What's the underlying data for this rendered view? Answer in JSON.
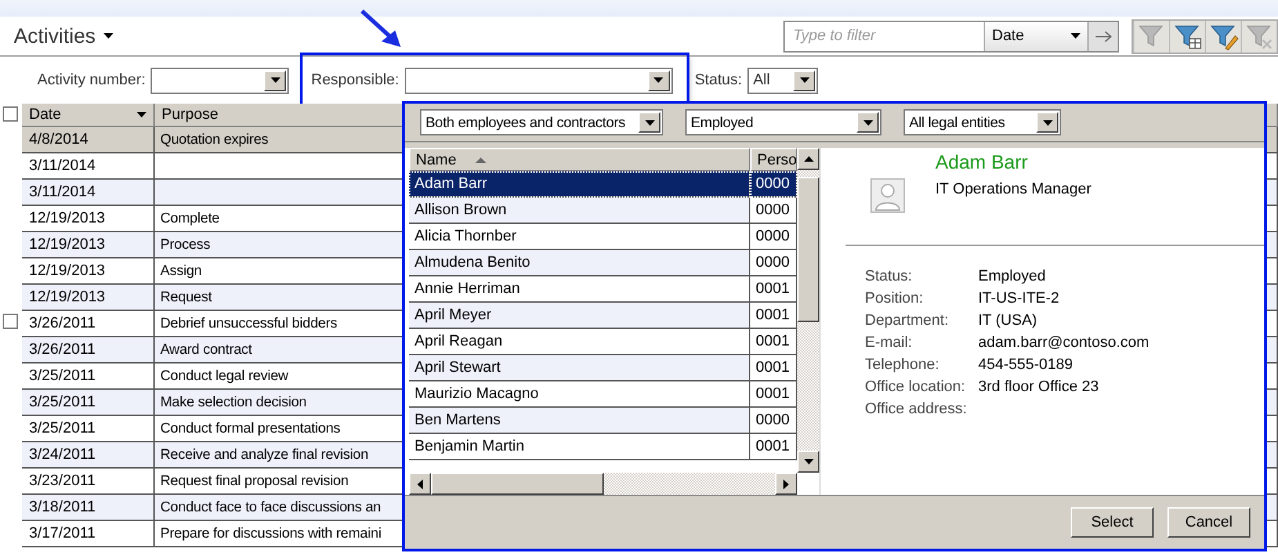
{
  "header": {
    "title": "Activities",
    "filter": {
      "placeholder": "Type to filter",
      "field": "Date"
    },
    "tools": [
      {
        "kind": "filter",
        "disabled": true
      },
      {
        "kind": "grid",
        "disabled": false
      },
      {
        "kind": "edit",
        "disabled": false
      },
      {
        "kind": "clear",
        "disabled": true
      }
    ]
  },
  "filters": [
    {
      "label": "Activity number:",
      "highlighted": false
    },
    {
      "label": "Responsible:",
      "highlighted": true
    },
    {
      "label": "Status:",
      "value": "All",
      "highlighted": false
    }
  ],
  "grid": {
    "select_all": {
      "checked": false
    },
    "columns": [
      "Date",
      "Purpose"
    ],
    "rows": [
      {
        "date": "4/8/2014",
        "purpose": "Quotation expires",
        "selected": true
      },
      {
        "date": "3/11/2014",
        "selected": false
      },
      {
        "date": "3/11/2014",
        "selected": false
      },
      {
        "date": "12/19/2013",
        "purpose": "Complete",
        "selected": false
      },
      {
        "date": "12/19/2013",
        "purpose": "Process",
        "selected": false
      },
      {
        "date": "12/19/2013",
        "purpose": "Assign",
        "selected": false
      },
      {
        "date": "12/19/2013",
        "purpose": "Request",
        "selected": false
      },
      {
        "date": "3/26/2011",
        "purpose": "Debrief unsuccessful bidders",
        "selected": false,
        "checkbox": {
          "checked": false
        }
      },
      {
        "date": "3/26/2011",
        "purpose": "Award contract",
        "selected": false
      },
      {
        "date": "3/25/2011",
        "purpose": "Conduct legal review",
        "selected": false
      },
      {
        "date": "3/25/2011",
        "purpose": "Make selection decision",
        "selected": false
      },
      {
        "date": "3/25/2011",
        "purpose": "Conduct formal presentations",
        "selected": false
      },
      {
        "date": "3/24/2011",
        "purpose": "Receive and analyze final revision",
        "selected": false
      },
      {
        "date": "3/23/2011",
        "purpose": "Request final proposal revision",
        "selected": false
      },
      {
        "date": "3/18/2011",
        "purpose": "Conduct face to face discussions an",
        "selected": false
      },
      {
        "date": "3/17/2011",
        "purpose": "Prepare for discussions with remaini",
        "selected": false
      }
    ]
  },
  "lookup": {
    "filters": [
      "Both employees and contractors",
      "Employed",
      "All legal entities"
    ],
    "columns": [
      "Name",
      "Perso"
    ],
    "rows": [
      {
        "name": "Adam Barr",
        "number": "0000",
        "selected": true
      },
      {
        "name": "Allison Brown",
        "number": "0000",
        "selected": false
      },
      {
        "name": "Alicia Thornber",
        "number": "0000",
        "selected": false
      },
      {
        "name": "Almudena Benito",
        "number": "0000",
        "selected": false
      },
      {
        "name": "Annie Herriman",
        "number": "0001",
        "selected": false
      },
      {
        "name": "April Meyer",
        "number": "0001",
        "selected": false
      },
      {
        "name": "April Reagan",
        "number": "0001",
        "selected": false
      },
      {
        "name": "April Stewart",
        "number": "0001",
        "selected": false
      },
      {
        "name": "Maurizio Macagno",
        "number": "0001",
        "selected": false
      },
      {
        "name": "Ben Martens",
        "number": "0000",
        "selected": false
      },
      {
        "name": "Benjamin Martin",
        "number": "0001",
        "selected": false
      }
    ],
    "profile": {
      "name": "Adam Barr",
      "title": "IT Operations Manager",
      "fields": [
        {
          "label": "Status:",
          "value": "Employed"
        },
        {
          "label": "Position:",
          "value": "IT-US-ITE-2"
        },
        {
          "label": "Department:",
          "value": "IT (USA)"
        },
        {
          "label": "E-mail:",
          "value": "adam.barr@contoso.com"
        },
        {
          "label": "Telephone:",
          "value": "454-555-0189"
        },
        {
          "label": "Office location:",
          "value": "3rd floor Office 23"
        },
        {
          "label": "Office address:"
        }
      ]
    },
    "buttons": [
      "Select",
      "Cancel"
    ]
  }
}
